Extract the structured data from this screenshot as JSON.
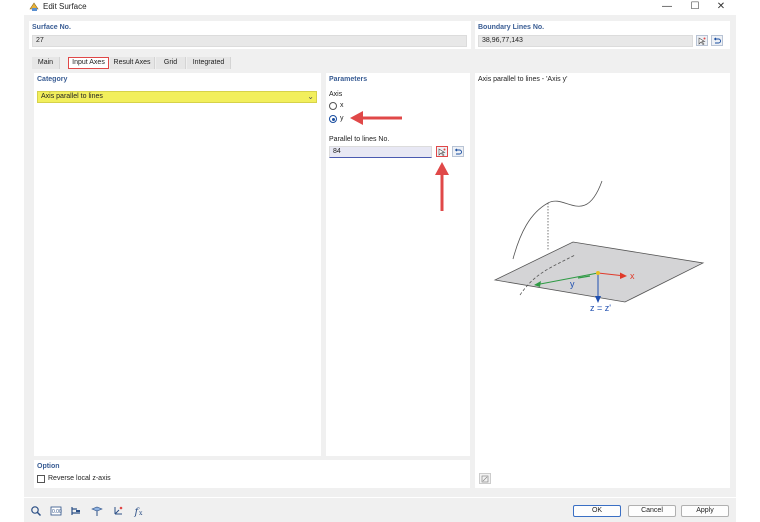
{
  "window": {
    "title": "Edit Surface"
  },
  "surface": {
    "label": "Surface No.",
    "value": "27"
  },
  "boundary": {
    "label": "Boundary Lines No.",
    "value": "38,96,77,143"
  },
  "tabs": [
    {
      "label": "Main"
    },
    {
      "label": "Input Axes"
    },
    {
      "label": "Result Axes"
    },
    {
      "label": "Grid"
    },
    {
      "label": "Integrated"
    }
  ],
  "category": {
    "label": "Category",
    "selected": "Axis parallel to lines"
  },
  "parameters": {
    "label": "Parameters",
    "axis_label": "Axis",
    "axis_options": [
      "x",
      "y"
    ],
    "axis_selected": "y",
    "parallel_label": "Parallel to lines No.",
    "parallel_value": "84"
  },
  "preview": {
    "title": "Axis parallel to lines - 'Axis y'",
    "x_label": "x",
    "y_label": "y",
    "z_label": "z = z'",
    "colors": {
      "x_axis": "#e03a2a",
      "y_axis": "#2e9a44",
      "z_axis": "#1f4fb0",
      "origin": "#e8c020"
    }
  },
  "option": {
    "label": "Option",
    "reverse_label": "Reverse local z-axis",
    "reverse_checked": false
  },
  "buttons": {
    "ok": "OK",
    "cancel": "Cancel",
    "apply": "Apply"
  },
  "toolbar_icons": [
    "zoom-icon",
    "units-icon",
    "numbering-icon",
    "view-icon",
    "axes-icon",
    "function-icon"
  ],
  "colors": {
    "accent": "#3a5d94",
    "highlight": "#e04848",
    "selection": "#f2ef5c"
  }
}
